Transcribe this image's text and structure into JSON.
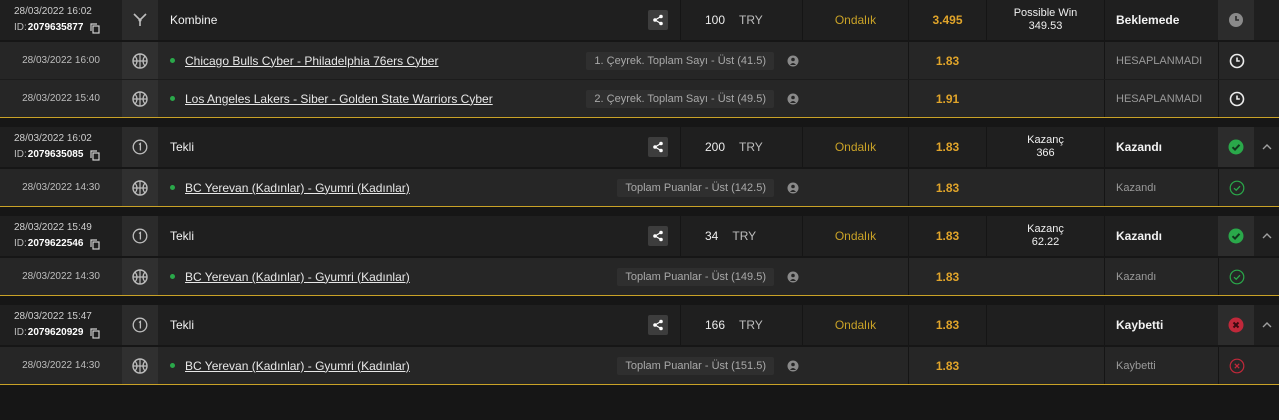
{
  "colors": {
    "accent": "#c9a227",
    "odds": "#e0a42a",
    "won": "#2aa84a",
    "lost": "#c0283a",
    "win_dot": "#2aa84a"
  },
  "bets": [
    {
      "date": "28/03/2022 16:02",
      "id_prefix": "ID:",
      "id": "2079635877",
      "type_icon": "combo-icon",
      "title": "Kombine",
      "stake": "100",
      "currency": "TRY",
      "odds_type": "Ondalık",
      "odds": "3.495",
      "win_label": "Possible Win",
      "win_value": "349.53",
      "status": "Beklemede",
      "status_icon": "pending-clock-icon",
      "legs": [
        {
          "date": "28/03/2022 16:00",
          "sport_icon": "basketball-icon",
          "match": "Chicago Bulls Cyber - Philadelphia 76ers Cyber",
          "market": "1. Çeyrek. Toplam Sayı - Üst (41.5)",
          "odds": "1.83",
          "status": "HESAPLANMADI",
          "status_icon": "clock-icon"
        },
        {
          "date": "28/03/2022 15:40",
          "sport_icon": "basketball-icon",
          "match": "Los Angeles Lakers - Siber - Golden State Warriors Cyber",
          "market": "2. Çeyrek. Toplam Sayı - Üst (49.5)",
          "odds": "1.91",
          "status": "HESAPLANMADI",
          "status_icon": "clock-icon"
        }
      ]
    },
    {
      "date": "28/03/2022 16:02",
      "id_prefix": "ID:",
      "id": "2079635085",
      "type_icon": "single-icon",
      "title": "Tekli",
      "stake": "200",
      "currency": "TRY",
      "odds_type": "Ondalık",
      "odds": "1.83",
      "win_label": "Kazanç",
      "win_value": "366",
      "status": "Kazandı",
      "status_icon": "won-check-icon",
      "legs": [
        {
          "date": "28/03/2022 14:30",
          "sport_icon": "basketball-icon",
          "match": "BC Yerevan (Kadınlar) - Gyumri (Kadınlar)",
          "market": "Toplam Puanlar - Üst (142.5)",
          "odds": "1.83",
          "status": "Kazandı",
          "status_icon": "check-outline-icon"
        }
      ]
    },
    {
      "date": "28/03/2022 15:49",
      "id_prefix": "ID:",
      "id": "2079622546",
      "type_icon": "single-icon",
      "title": "Tekli",
      "stake": "34",
      "currency": "TRY",
      "odds_type": "Ondalık",
      "odds": "1.83",
      "win_label": "Kazanç",
      "win_value": "62.22",
      "status": "Kazandı",
      "status_icon": "won-check-icon",
      "legs": [
        {
          "date": "28/03/2022 14:30",
          "sport_icon": "basketball-icon",
          "match": "BC Yerevan (Kadınlar) - Gyumri (Kadınlar)",
          "market": "Toplam Puanlar - Üst (149.5)",
          "odds": "1.83",
          "status": "Kazandı",
          "status_icon": "check-outline-icon"
        }
      ]
    },
    {
      "date": "28/03/2022 15:47",
      "id_prefix": "ID:",
      "id": "2079620929",
      "type_icon": "single-icon",
      "title": "Tekli",
      "stake": "166",
      "currency": "TRY",
      "odds_type": "Ondalık",
      "odds": "1.83",
      "win_label": "",
      "win_value": "",
      "status": "Kaybetti",
      "status_icon": "lost-x-icon",
      "legs": [
        {
          "date": "28/03/2022 14:30",
          "sport_icon": "basketball-icon",
          "match": "BC Yerevan (Kadınlar) - Gyumri (Kadınlar)",
          "market": "Toplam Puanlar - Üst (151.5)",
          "odds": "1.83",
          "status": "Kaybetti",
          "status_icon": "x-outline-icon"
        }
      ]
    }
  ]
}
